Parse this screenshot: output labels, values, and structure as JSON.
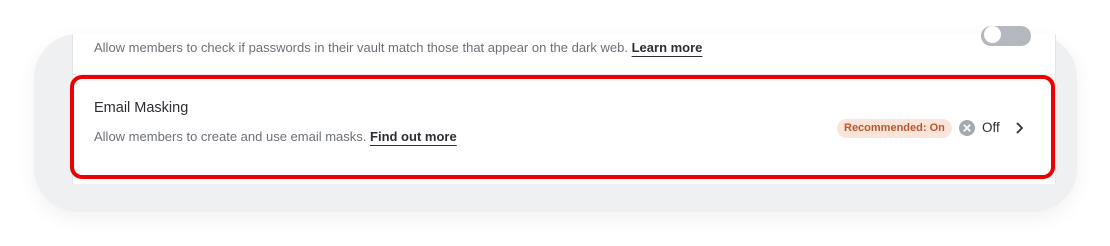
{
  "dark_web_row": {
    "description": "Allow members to check if passwords in their vault match those that appear on the dark web.",
    "link_label": "Learn more",
    "toggle_state": "off"
  },
  "email_masking_row": {
    "title": "Email Masking",
    "description": "Allow members to create and use email masks.",
    "link_label": "Find out more",
    "badge_label": "Recommended: On",
    "status_icon": "x-circle-icon",
    "status_label": "Off",
    "chevron_icon": "chevron-right-icon"
  },
  "colors": {
    "highlight_border": "#ee0000",
    "badge_text": "#b4582d",
    "badge_bg": "#fbe5da"
  }
}
